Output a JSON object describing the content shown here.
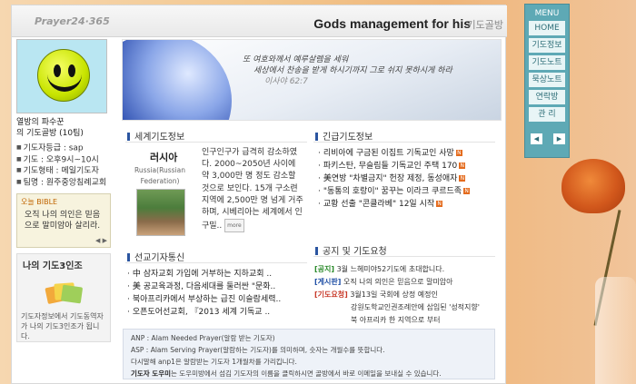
{
  "header": {
    "logo": "Prayer24·365",
    "title": "Gods management for his",
    "subtitle": "기도골방"
  },
  "profile": {
    "greeting_line1": "열방의 파수꾼",
    "greeting_line2": "의 기도골방 (10팀)",
    "stats": [
      "기도자등급 : sap",
      "기도 : 오후9시~10시",
      "기도형태 : 메일기도자",
      "팀명 : 원주중앙침례교회"
    ]
  },
  "bible": {
    "label": "오늘 BIBLE",
    "text": "오직 나의 의인은 믿음으로 말미암아 살리라.",
    "arrows": "◀ ▶"
  },
  "three": {
    "title": "나의 기도3인조",
    "description": "기도자정보에서 기도동역자가 나의 기도3인조가 됩니다."
  },
  "banner": {
    "line1": "또 여호와께서 예루살렘을 세워",
    "line2": "세상에서 찬송을 받게 하시기까지 그로 쉬지 못하시게 하라",
    "reference": "이사야 62:7"
  },
  "world": {
    "title": "세계기도정보",
    "country": "러시아",
    "country_en": "Russia(Russian Federation)",
    "text": "인구인구가 급격히 감소하였다. 2000~2050년 사이에 약 3,000만 명 정도 감소할 것으로 보인다. 15개 구소련 지역에 2,500만 명 넘게 거주하며, 시베리아는 세계에서 인구밀..",
    "more": "more"
  },
  "urgent": {
    "title": "긴급기도정보",
    "items": [
      "리비아에 구금된 이집트 기독교인 사망",
      "파키스탄, 무슬림들 기독교인 주택 170",
      "美연방 \"차별금지\" 헌장 제정, 동성애자",
      "\"동통의 호랑이\" 꿈꾸는 이라크 쿠르드족",
      "교황 선출 \"콘클라베\" 12일 시작"
    ]
  },
  "mission": {
    "title": "선교기자통신",
    "items": [
      "中 삼자교회 가입에 거부하는 지하교회 ..",
      "美 공교육과정, 다음세대를 둘러싼 \"문화..",
      "북아프리카에서 부상하는 급진 이슬람세력..",
      "오픈도어선교회, 『2013 세계 기독교 .."
    ]
  },
  "notice": {
    "title": "공지 및 기도요청",
    "items": [
      {
        "tag": "[공지]",
        "text": "3월 느헤미야52기도에 초대합니다."
      },
      {
        "tag": "[게시판]",
        "text": "오직 나의 의인은 믿음으로 말미암아"
      },
      {
        "tag": "[기도요청]",
        "text": "3월13일 국회에 상정 예정인"
      }
    ],
    "extra1": "강원도학교인권조례안에 삽입된 '성적지향'",
    "extra2": "북 아프리카 한 지역으로 부터"
  },
  "bottom": {
    "anp": "ANP : Alam Needed Prayer(알람 받는 기도자)",
    "asp": "ASP : Alam Serving Prayer(알람하는 기도자)를 의미하며, 숫자는 개월수를 뜻합니다.",
    "line3": "다시말해 anp1은 알람받는 기도자 1개월차를 가리킵니다.",
    "helper_label": "기도자 도우미",
    "helper": "는 도우미방에서 섬김 기도자의 이름을 클릭하시면 골방에서 바로 이메일을 보내실 수 있습니다."
  },
  "menu": {
    "head": "MENU",
    "items": [
      "HOME",
      "기도정보",
      "기도노트",
      "묵상노트",
      "연락방",
      "관 리"
    ],
    "arrows": [
      "◀",
      "▶"
    ]
  },
  "colors": {
    "menu": "#5ea9b5",
    "accent_blue": "#2b55a0",
    "new_badge": "#e46b1d"
  }
}
